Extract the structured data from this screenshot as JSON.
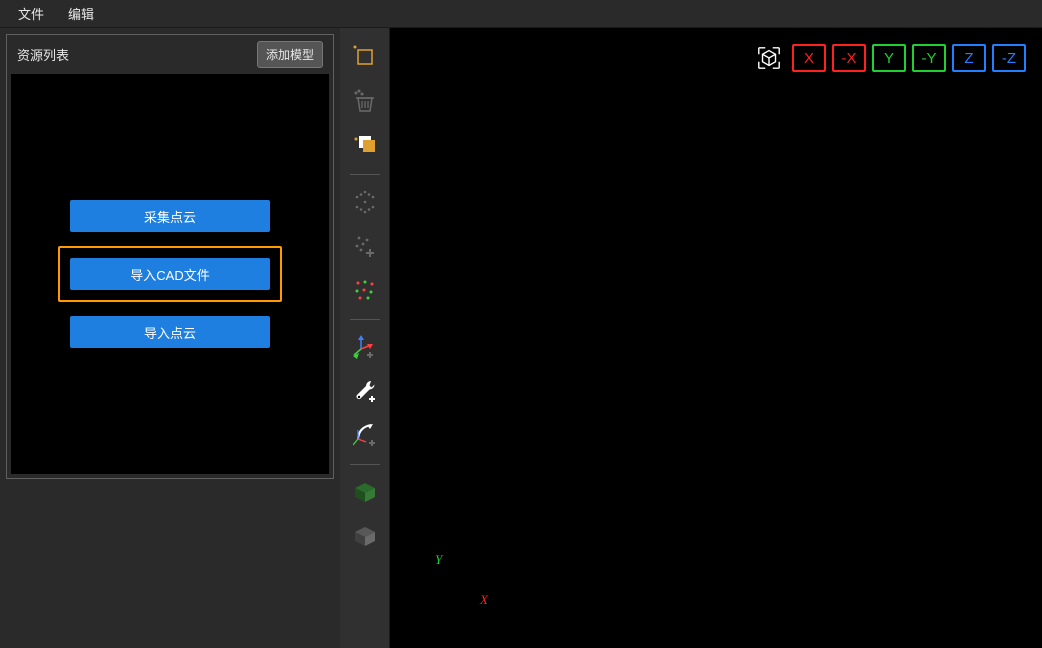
{
  "menu": {
    "file": "文件",
    "edit": "编辑"
  },
  "panel": {
    "title": "资源列表",
    "add_model": "添加模型",
    "collect_point_cloud": "采集点云",
    "import_cad_file": "导入CAD文件",
    "import_point_cloud": "导入点云"
  },
  "viewButtons": {
    "xp": "X",
    "xn": "-X",
    "yp": "Y",
    "yn": "-Y",
    "zp": "Z",
    "zn": "-Z"
  },
  "axes": {
    "y": "Y",
    "x": "X"
  },
  "colors": {
    "x": "#ff2020",
    "y": "#20d030",
    "z": "#2080ff",
    "highlight": "#ff9a00",
    "toolActive": "#e0a030",
    "toolMuted": "#6a6a6a",
    "white": "#ffffff"
  }
}
